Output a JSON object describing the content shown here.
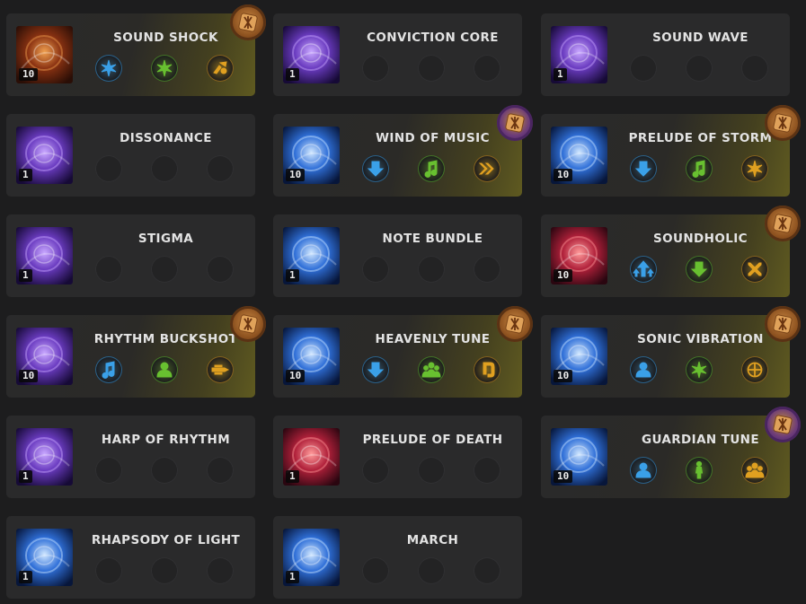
{
  "cards": [
    {
      "name": "SOUND SHOCK",
      "level": "10",
      "gold": true,
      "art": "art-orange",
      "rune": "orange",
      "tripods": [
        {
          "icon": "burst-icon",
          "color": "#3aa0e8"
        },
        {
          "icon": "burst-icon",
          "color": "#68c030"
        },
        {
          "icon": "horns-icon",
          "color": "#e0a020"
        }
      ]
    },
    {
      "name": "CONVICTION CORE",
      "level": "1",
      "gold": false,
      "art": "art-violet",
      "rune": null,
      "tripods": [
        null,
        null,
        null
      ]
    },
    {
      "name": "SOUND WAVE",
      "level": "1",
      "gold": false,
      "art": "art-violet",
      "rune": null,
      "tripods": [
        null,
        null,
        null
      ]
    },
    {
      "name": "DISSONANCE",
      "level": "1",
      "gold": false,
      "art": "art-violet",
      "rune": null,
      "tripods": [
        null,
        null,
        null
      ]
    },
    {
      "name": "WIND OF MUSIC",
      "level": "10",
      "gold": true,
      "art": "art-blue",
      "rune": "purple",
      "tripods": [
        {
          "icon": "down-arrow-icon",
          "color": "#3aa0e8"
        },
        {
          "icon": "music-note-icon",
          "color": "#68c030"
        },
        {
          "icon": "double-chevron-icon",
          "color": "#e0a020"
        }
      ]
    },
    {
      "name": "PRELUDE OF STORM",
      "level": "10",
      "gold": true,
      "art": "art-blue",
      "rune": "orange",
      "tripods": [
        {
          "icon": "down-arrow-icon",
          "color": "#3aa0e8"
        },
        {
          "icon": "music-note-icon",
          "color": "#68c030"
        },
        {
          "icon": "burst-icon",
          "color": "#e0a020"
        }
      ]
    },
    {
      "name": "STIGMA",
      "level": "1",
      "gold": false,
      "art": "art-violet",
      "rune": null,
      "tripods": [
        null,
        null,
        null
      ]
    },
    {
      "name": "NOTE BUNDLE",
      "level": "1",
      "gold": false,
      "art": "art-blue",
      "rune": null,
      "tripods": [
        null,
        null,
        null
      ]
    },
    {
      "name": "SOUNDHOLIC",
      "level": "10",
      "gold": true,
      "art": "art-red",
      "rune": "orange",
      "tripods": [
        {
          "icon": "up-arrows-icon",
          "color": "#3aa0e8"
        },
        {
          "icon": "down-arrow-icon",
          "color": "#68c030"
        },
        {
          "icon": "cross-swords-icon",
          "color": "#e0a020"
        }
      ]
    },
    {
      "name": "RHYTHM BUCKSHOT",
      "level": "10",
      "gold": true,
      "art": "art-violet",
      "rune": "orange",
      "tripods": [
        {
          "icon": "music-note-icon",
          "color": "#3aa0e8"
        },
        {
          "icon": "person-icon",
          "color": "#68c030"
        },
        {
          "icon": "speed-lines-icon",
          "color": "#e0a020"
        }
      ]
    },
    {
      "name": "HEAVENLY TUNE",
      "level": "10",
      "gold": true,
      "art": "art-blue",
      "rune": "orange",
      "tripods": [
        {
          "icon": "down-arrow-icon",
          "color": "#3aa0e8"
        },
        {
          "icon": "group-icon",
          "color": "#68c030"
        },
        {
          "icon": "hook-icon",
          "color": "#e0a020"
        }
      ]
    },
    {
      "name": "SONIC VIBRATION",
      "level": "10",
      "gold": true,
      "art": "art-blue",
      "rune": "orange",
      "tripods": [
        {
          "icon": "person-icon",
          "color": "#3aa0e8"
        },
        {
          "icon": "burst-icon",
          "color": "#68c030"
        },
        {
          "icon": "target-icon",
          "color": "#e0a020"
        }
      ]
    },
    {
      "name": "HARP OF RHYTHM",
      "level": "1",
      "gold": false,
      "art": "art-violet",
      "rune": null,
      "tripods": [
        null,
        null,
        null
      ]
    },
    {
      "name": "PRELUDE OF DEATH",
      "level": "1",
      "gold": false,
      "art": "art-red",
      "rune": null,
      "tripods": [
        null,
        null,
        null
      ]
    },
    {
      "name": "GUARDIAN TUNE",
      "level": "10",
      "gold": true,
      "art": "art-blue",
      "rune": "purple",
      "tripods": [
        {
          "icon": "person-icon",
          "color": "#3aa0e8"
        },
        {
          "icon": "standing-person-icon",
          "color": "#68c030"
        },
        {
          "icon": "group-icon",
          "color": "#e0a020"
        }
      ]
    },
    {
      "name": "RHAPSODY OF LIGHT",
      "level": "1",
      "gold": false,
      "art": "art-blue",
      "rune": null,
      "tripods": [
        null,
        null,
        null
      ]
    },
    {
      "name": "MARCH",
      "level": "1",
      "gold": false,
      "art": "art-blue",
      "rune": null,
      "tripods": [
        null,
        null,
        null
      ]
    }
  ],
  "colors": {
    "background": "#1d1d1e",
    "card": "#2a2a2b",
    "gold_tint": "#5f5a20",
    "rune_orange": "#b07030",
    "rune_purple": "#6b3a7a"
  }
}
